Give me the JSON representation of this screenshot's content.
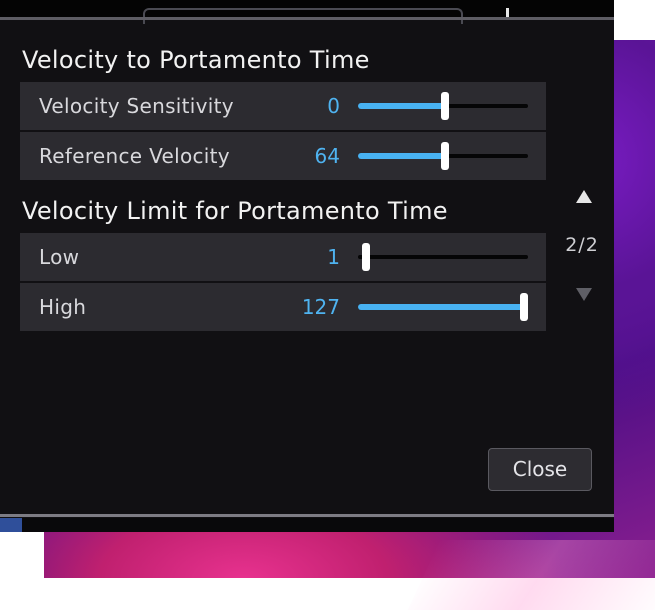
{
  "dialog": {
    "section1_title": "Velocity to Portamento Time",
    "section2_title": "Velocity Limit for Portamento Time",
    "rows": [
      {
        "label": "Velocity Sensitivity",
        "value": "0",
        "level": 0.5
      },
      {
        "label": "Reference Velocity",
        "value": "64",
        "level": 0.5
      },
      {
        "label": "Low",
        "value": "1",
        "level": 0.0
      },
      {
        "label": "High",
        "value": "127",
        "level": 1.0
      }
    ],
    "pager": {
      "text": "2/2"
    },
    "close_label": "Close"
  },
  "colors": {
    "accent": "#48b2f2",
    "value_text": "#4fb3f0",
    "panel_bg": "#111013",
    "row_bg": "#2c2b30"
  }
}
